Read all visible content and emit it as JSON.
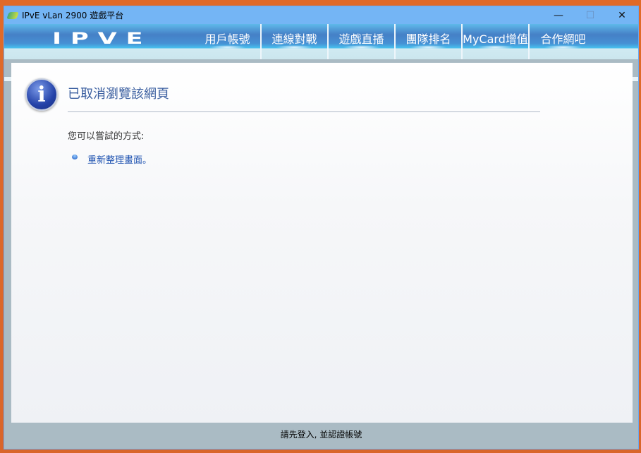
{
  "window": {
    "title": "IPvE vLan 2900 遊戲平台",
    "minimize": "—",
    "maximize": "☐",
    "close": "✕"
  },
  "nav": {
    "logo": "IPVE",
    "items": [
      "用戶帳號",
      "連線對戰",
      "遊戲直播",
      "團隊排名",
      "MyCard增值",
      "合作網吧"
    ]
  },
  "content": {
    "heading": "已取消瀏覽該網頁",
    "try_label": "您可以嘗試的方式:",
    "refresh_link": "重新整理畫面。",
    "info_glyph": "i"
  },
  "status": {
    "text": "請先登入, 並認證帳號"
  }
}
